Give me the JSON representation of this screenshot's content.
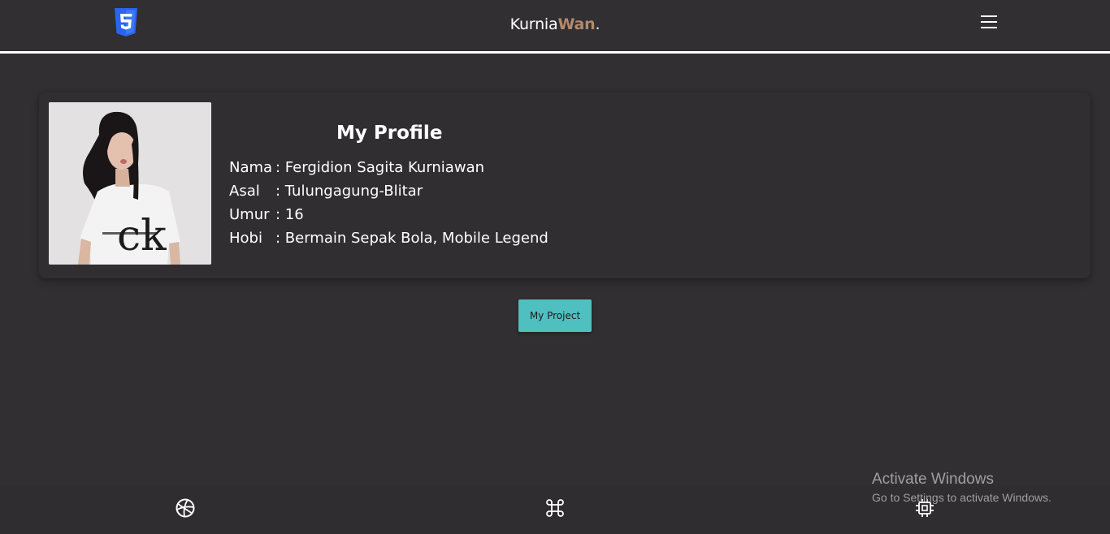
{
  "header": {
    "brand_main": "Kurnia",
    "brand_highlight": "Wan",
    "brand_suffix": ".",
    "logo_icon": "css3-logo",
    "menu_icon": "hamburger-menu-icon"
  },
  "profile": {
    "title": "My Profile",
    "photo_alt": "profile-photo",
    "rows": [
      {
        "label": "Nama",
        "value": ": Fergidion Sagita Kurniawan"
      },
      {
        "label": "Asal",
        "value": ": Tulungagung-Blitar"
      },
      {
        "label": "Umur",
        "value": ": 16"
      },
      {
        "label": "Hobi",
        "value": ": Bermain Sepak Bola, Mobile Legend"
      }
    ]
  },
  "actions": {
    "project_button": "My Project"
  },
  "footer": {
    "icons": [
      "basketball-icon",
      "command-icon",
      "cpu-chip-icon"
    ]
  },
  "watermark": {
    "title": "Activate Windows",
    "subtitle": "Go to Settings to activate Windows."
  },
  "colors": {
    "background": "#312f31",
    "brand_highlight": "#b28a6d",
    "button": "#4fbfbf",
    "logo_blue": "#2965f1"
  }
}
